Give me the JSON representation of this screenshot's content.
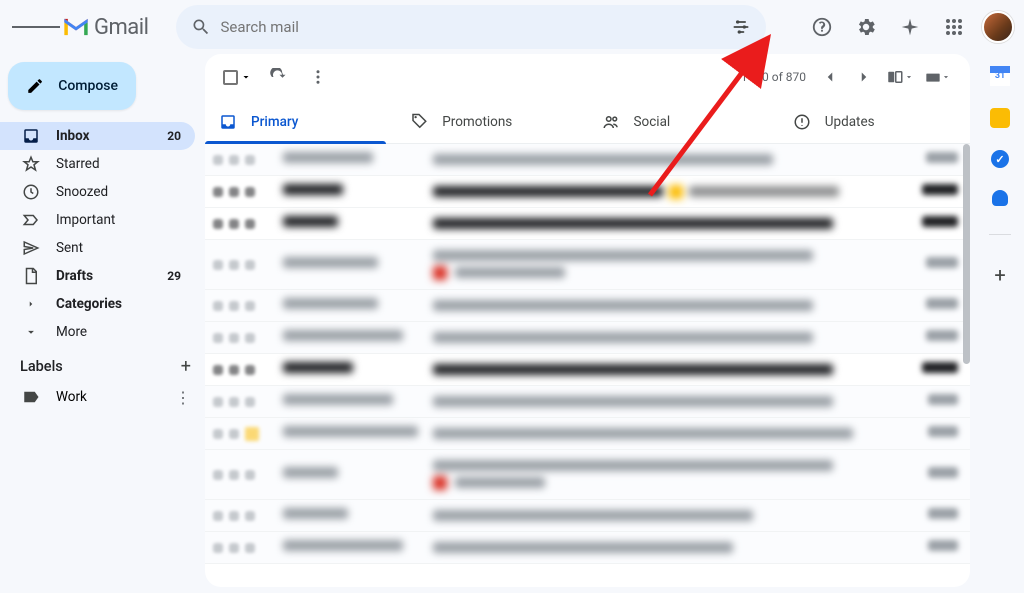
{
  "app_name": "Gmail",
  "search_placeholder": "Search mail",
  "compose_label": "Compose",
  "nav": [
    {
      "id": "inbox",
      "label": "Inbox",
      "count": "20",
      "active": true,
      "bold": true
    },
    {
      "id": "starred",
      "label": "Starred"
    },
    {
      "id": "snoozed",
      "label": "Snoozed"
    },
    {
      "id": "important",
      "label": "Important"
    },
    {
      "id": "sent",
      "label": "Sent"
    },
    {
      "id": "drafts",
      "label": "Drafts",
      "count": "29",
      "bold": true
    },
    {
      "id": "categories",
      "label": "Categories",
      "bold": true
    },
    {
      "id": "more",
      "label": "More"
    }
  ],
  "labels_header": "Labels",
  "labels": [
    {
      "id": "work",
      "label": "Work"
    }
  ],
  "pagination": "1–50 of 870",
  "tabs": [
    {
      "id": "primary",
      "label": "Primary",
      "active": true
    },
    {
      "id": "promotions",
      "label": "Promotions"
    },
    {
      "id": "social",
      "label": "Social"
    },
    {
      "id": "updates",
      "label": "Updates"
    }
  ],
  "rows": [
    {
      "unread": false,
      "sender_w": 90,
      "subj_w": 340,
      "time_w": 32
    },
    {
      "unread": true,
      "sender_w": 60,
      "subj_w": 230,
      "time_w": 36,
      "yel_after_subj": true,
      "tail_w": 150
    },
    {
      "unread": true,
      "sender_w": 55,
      "subj_w": 400,
      "time_w": 36
    },
    {
      "unread": false,
      "sender_w": 95,
      "subj_w": 380,
      "time_w": 32,
      "two_line": true,
      "red": true,
      "line2_w": 110
    },
    {
      "unread": false,
      "sender_w": 95,
      "subj_w": 380,
      "time_w": 32
    },
    {
      "unread": false,
      "sender_w": 120,
      "subj_w": 380,
      "time_w": 32
    },
    {
      "unread": true,
      "sender_w": 70,
      "subj_w": 400,
      "time_w": 36
    },
    {
      "unread": false,
      "sender_w": 110,
      "subj_w": 400,
      "time_w": 30
    },
    {
      "unread": false,
      "sender_w": 135,
      "subj_w": 420,
      "time_w": 30,
      "yel_before": true
    },
    {
      "unread": false,
      "sender_w": 55,
      "subj_w": 400,
      "time_w": 30,
      "two_line": true,
      "red": true,
      "line2_w": 90
    },
    {
      "unread": false,
      "sender_w": 65,
      "subj_w": 320,
      "time_w": 30
    },
    {
      "unread": false,
      "sender_w": 120,
      "subj_w": 300,
      "time_w": 30
    }
  ]
}
